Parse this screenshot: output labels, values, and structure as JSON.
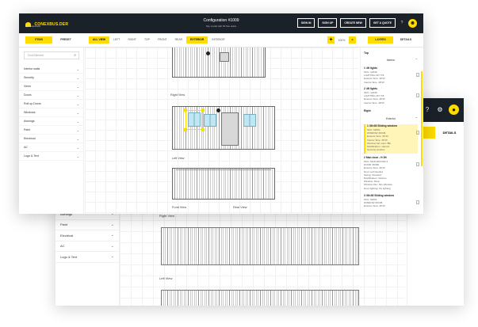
{
  "back": {
    "tabs": [
      "",
      "DETAILS"
    ],
    "categories": [
      "Awnings",
      "Paint",
      "Electrical",
      "AC",
      "Logo & Text"
    ],
    "views": [
      "Right View",
      "Left View"
    ]
  },
  "header": {
    "logo_text": "CONEXBUS.DER",
    "logo_sub": "by Conexwest",
    "config_title": "Configuration #1009",
    "config_sub": "Sky model with 60 frac stairs",
    "buttons": [
      "SIGN IN",
      "SIGN UP",
      "CREATE NEW",
      "GET A QUOTE"
    ],
    "help_icon": "?",
    "avatar_icon": "user-icon"
  },
  "toolbar": {
    "left_tabs": [
      "ITEMS",
      "PRESET"
    ],
    "view_tabs": [
      "ALL VIEW",
      "LEFT",
      "RIGHT",
      "TOP",
      "FRONT",
      "REAR",
      "EXTERIOR",
      "INTERIOR"
    ],
    "zoom_minus": "+",
    "zoom_value": "100%",
    "zoom_plus": "-",
    "right_tabs": [
      "LAYERS",
      "DETAILS"
    ]
  },
  "sidebar": {
    "search_placeholder": "Find Element",
    "categories": [
      "Interior walls",
      "Security",
      "Vents",
      "Doors",
      "Roll up Doors",
      "Windows",
      "Awnings",
      "Paint",
      "Electrical",
      "AC",
      "Logo & Text"
    ]
  },
  "canvas": {
    "views": [
      "Right View",
      "Left View",
      "Front View",
      "Rear View"
    ]
  },
  "layers": {
    "top_label": "Top",
    "interior_label": "Interior",
    "right_label": "Right",
    "exterior_label": "Exterior",
    "items": [
      {
        "title": "1  4ft lights",
        "lines": [
          "SKU: 12345",
          "LIGHTING 4FT T8",
          "Exterior Size: 48\"W",
          "Interior Size: 48\"W"
        ]
      },
      {
        "title": "2  4ft lights",
        "lines": [
          "SKU: 12345",
          "LIGHTING 4FT T8",
          "Exterior Size: 48\"W",
          "Interior Size: 48\"W"
        ]
      },
      {
        "title": "1  36×36 Sliding window",
        "lines": [
          "SKU: 52001",
          "WINDOW 36X36",
          "Exterior Size: 36\"W",
          "Interior Size: 36\"W",
          "Window bar color: Blk",
          "Modification: various",
          "Security window"
        ]
      },
      {
        "title": "2  Man door - H 3ft",
        "lines": [
          "SKU: MAN-RDOOR-3",
          "DOOR 36X80",
          "Exterior Size: 36\"W",
          "Door Left handed",
          "Swing: Outward",
          "Modification: Various",
          "Window: None",
          "Window trim: Sky Window",
          "Door lighting: No lighting"
        ]
      },
      {
        "title": "3  36×36 Sliding window",
        "lines": [
          "SKU: 52001",
          "WINDOW 36X36",
          "Exterior Size: 36\"W"
        ]
      }
    ]
  }
}
